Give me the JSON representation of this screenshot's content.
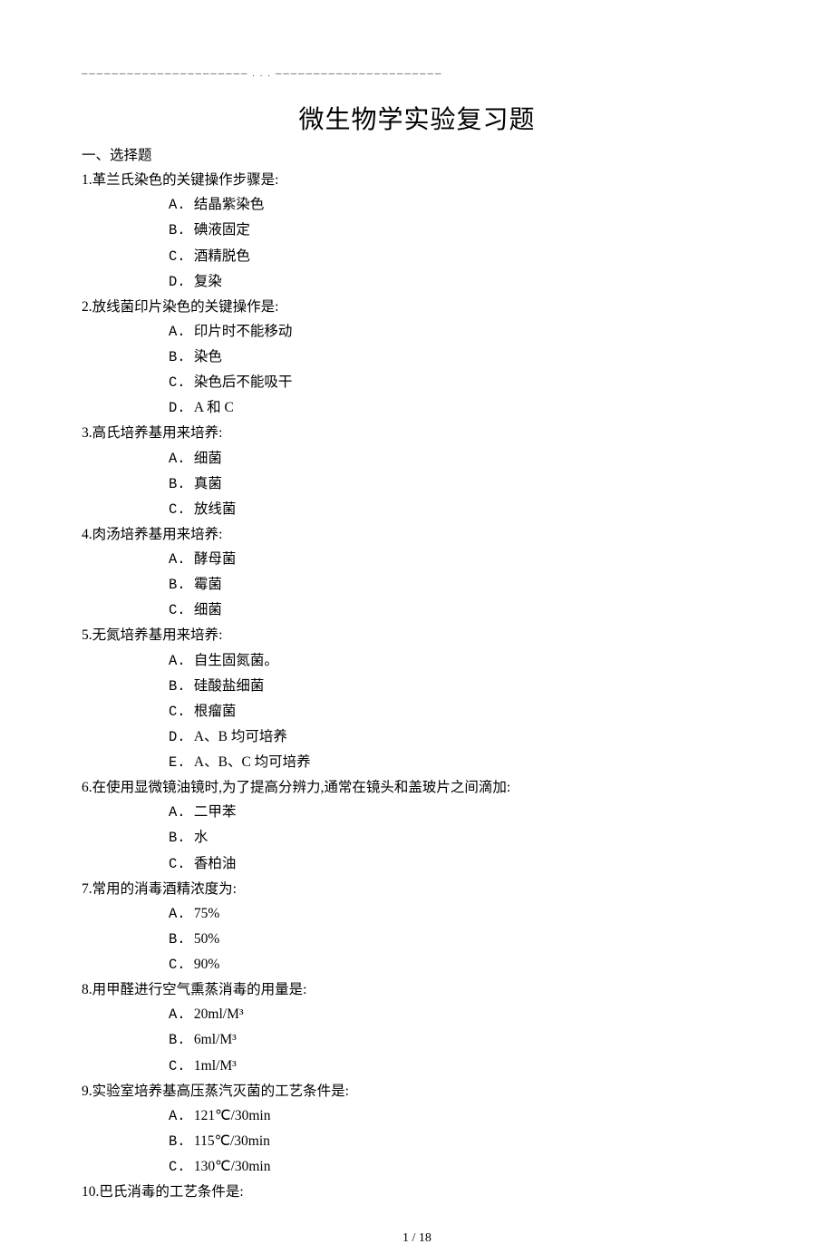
{
  "title": "微生物学实验复习题",
  "sectionHeading": "一、选择题",
  "questions": [
    {
      "num": "1.",
      "text": "革兰氏染色的关键操作步骤是:",
      "options": [
        {
          "l": "A.",
          "t": "结晶紫染色"
        },
        {
          "l": "B.",
          "t": "碘液固定"
        },
        {
          "l": "C.",
          "t": "酒精脱色"
        },
        {
          "l": "D.",
          "t": "复染"
        }
      ]
    },
    {
      "num": "2.",
      "text": "放线菌印片染色的关键操作是:",
      "options": [
        {
          "l": "A.",
          "t": "印片时不能移动"
        },
        {
          "l": "B.",
          "t": "染色"
        },
        {
          "l": "C.",
          "t": "染色后不能吸干"
        },
        {
          "l": "D.",
          "t": "A 和 C"
        }
      ]
    },
    {
      "num": "3.",
      "text": "高氏培养基用来培养:",
      "options": [
        {
          "l": "A.",
          "t": "细菌"
        },
        {
          "l": "B.",
          "t": "真菌"
        },
        {
          "l": "C.",
          "t": "放线菌"
        }
      ]
    },
    {
      "num": "4.",
      "text": "肉汤培养基用来培养:",
      "options": [
        {
          "l": "A.",
          "t": "酵母菌"
        },
        {
          "l": "B.",
          "t": "霉菌"
        },
        {
          "l": "C.",
          "t": "细菌"
        }
      ]
    },
    {
      "num": "5.",
      "text": "无氮培养基用来培养:",
      "options": [
        {
          "l": "A.",
          "t": "自生固氮菌。"
        },
        {
          "l": "B.",
          "t": "硅酸盐细菌"
        },
        {
          "l": "C.",
          "t": "根瘤菌"
        },
        {
          "l": "D.",
          "t": " A、B 均可培养"
        },
        {
          "l": "E.",
          "t": " A、B、C 均可培养"
        }
      ]
    },
    {
      "num": "6.",
      "text": "在使用显微镜油镜时,为了提高分辨力,通常在镜头和盖玻片之间滴加:",
      "options": [
        {
          "l": "A.",
          "t": "二甲苯"
        },
        {
          "l": "B.",
          "t": "水"
        },
        {
          "l": "C.",
          "t": "香柏油"
        }
      ]
    },
    {
      "num": "7.",
      "text": "常用的消毒酒精浓度为:",
      "options": [
        {
          "l": "A.",
          "t": "75%"
        },
        {
          "l": "B.",
          "t": "50%"
        },
        {
          "l": "C.",
          "t": "90%"
        }
      ]
    },
    {
      "num": "8.",
      "text": "用甲醛进行空气熏蒸消毒的用量是:",
      "options": [
        {
          "l": "A.",
          "t": "20ml/M³"
        },
        {
          "l": "B.",
          "t": "6ml/M³"
        },
        {
          "l": "C.",
          "t": "1ml/M³"
        }
      ]
    },
    {
      "num": "9.",
      "text": "实验室培养基高压蒸汽灭菌的工艺条件是:",
      "options": [
        {
          "l": "A.",
          "t": "121℃/30min"
        },
        {
          "l": "B.",
          "t": "115℃/30min"
        },
        {
          "l": "C.",
          "t": "130℃/30min"
        }
      ]
    },
    {
      "num": "10.",
      "text": "巴氏消毒的工艺条件是:",
      "options": []
    }
  ],
  "footer": "1 / 18",
  "headerLine": "────────────────────── .                           .                          . ──────────────────────"
}
